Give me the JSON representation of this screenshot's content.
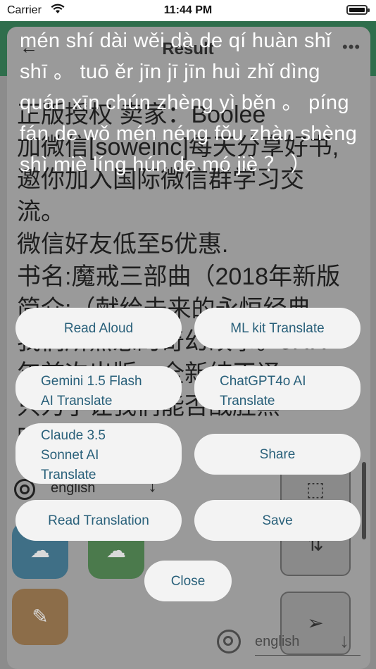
{
  "status_bar": {
    "carrier": "Carrier",
    "time": "11:44 PM"
  },
  "header": {
    "title": "Result"
  },
  "page": {
    "text": "正版授权 卖家：Boolee\n加微信[soweinc]每天分享好书,邀你加入国际微信群学习交流。\n微信好友低至5优惠.\n书名:魔戒三部曲（2018年新版\n简介:（献给未来的永恒经典\n我们所熟悉的奇幻故事。JRR\n年首次出版，全新纯正译\n只为了让我们能否战胜黑\n暗骑作魔戒？）"
  },
  "source_language": "english",
  "target_language": "english",
  "overlay": {
    "pinyin": "mén shí dài wěi dà de qí huàn shǐ shī 。 tuō ěr jīn jī jīn huì zhǐ dìng quán xīn chún zhèng yì běn 。 píng fán de wǒ mén néng fǒu zhàn shèng shì miè líng hún de mó jiè ？ ）"
  },
  "actions": {
    "read_aloud": "Read Aloud",
    "ml_kit": "ML kit Translate",
    "gemini_l1": "Gemini 1.5 Flash",
    "gemini_l2": "AI Translate",
    "chatgpt_l1": "ChatGPT4o AI",
    "chatgpt_l2": "Translate",
    "claude_l1": "Claude 3.5",
    "claude_l2": "Sonnet AI",
    "claude_l3": "Translate",
    "share": "Share",
    "read_translation": "Read Translation",
    "save": "Save",
    "close": "Close"
  },
  "colors": {
    "header": "#2f6e4c",
    "button_text": "#29607a",
    "button_bg": "#f3f3f3"
  },
  "icons": [
    "wifi-icon",
    "battery-icon",
    "back-arrow-icon",
    "more-icon",
    "target-icon",
    "download-arrow-icon",
    "cloud-upload-icon",
    "edit-icon",
    "crop-icon",
    "swap-icon",
    "send-icon"
  ]
}
